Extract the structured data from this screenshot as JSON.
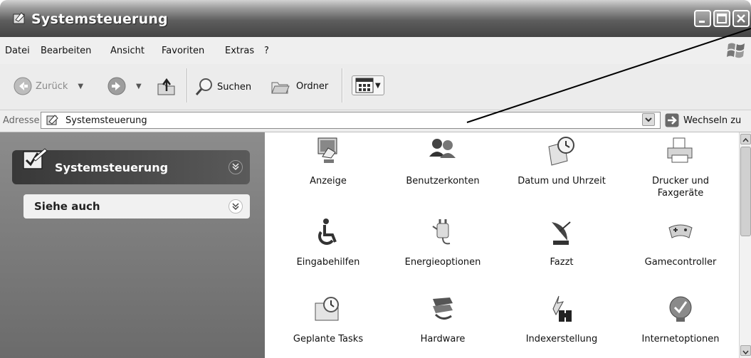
{
  "window": {
    "title": "Systemsteuerung"
  },
  "menubar": {
    "items": [
      "Datei",
      "Bearbeiten",
      "Ansicht",
      "Favoriten",
      "Extras",
      "?"
    ]
  },
  "toolbar": {
    "back_label": "Zurück",
    "search_label": "Suchen",
    "folders_label": "Ordner"
  },
  "address": {
    "label": "Adresse",
    "value": "Systemsteuerung",
    "go_label": "Wechseln zu"
  },
  "taskpane": {
    "panel_title": "Systemsteuerung",
    "see_also_title": "Siehe auch"
  },
  "items": [
    {
      "label": "Anzeige",
      "icon": "display-icon"
    },
    {
      "label": "Benutzerkonten",
      "icon": "user-accounts-icon"
    },
    {
      "label": "Datum und Uhrzeit",
      "icon": "date-time-icon"
    },
    {
      "label": "Drucker und Faxgeräte",
      "icon": "printer-fax-icon"
    },
    {
      "label": "Eingabehilfen",
      "icon": "accessibility-icon"
    },
    {
      "label": "Energieoptionen",
      "icon": "power-options-icon"
    },
    {
      "label": "Fazzt",
      "icon": "satellite-dish-icon"
    },
    {
      "label": "Gamecontroller",
      "icon": "gamepad-icon"
    },
    {
      "label": "Geplante Tasks",
      "icon": "scheduled-tasks-icon"
    },
    {
      "label": "Hardware",
      "icon": "hardware-icon"
    },
    {
      "label": "Indexerstellung",
      "icon": "indexing-icon"
    },
    {
      "label": "Internetoptionen",
      "icon": "internet-options-icon"
    }
  ]
}
